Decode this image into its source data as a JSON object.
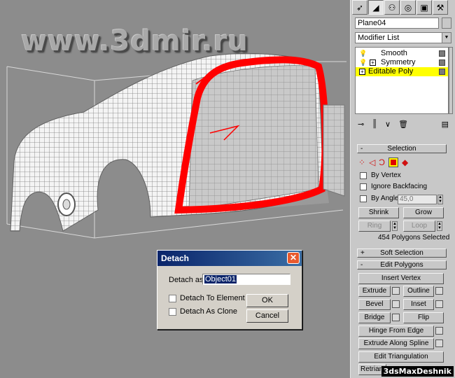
{
  "watermark": "www.3dmir.ru",
  "credit": "3dsMaxDeshnik",
  "detach_dialog": {
    "title": "Detach",
    "detach_as_label": "Detach as:",
    "detach_as_value": "Object01",
    "to_element_label": "Detach To Element",
    "as_clone_label": "Detach As Clone",
    "ok_label": "OK",
    "cancel_label": "Cancel"
  },
  "panel": {
    "tabs": [
      "create-icon",
      "modify-icon",
      "hierarchy-icon",
      "motion-icon",
      "display-icon",
      "utilities-icon"
    ],
    "object_name": "Plane04",
    "modifier_list": "Modifier List",
    "stack": [
      {
        "label": "Smooth",
        "selected": false
      },
      {
        "label": "Symmetry",
        "selected": false
      },
      {
        "label": "Editable Poly",
        "selected": true
      }
    ],
    "selection": {
      "title": "Selection",
      "by_vertex": "By Vertex",
      "ignore_backfacing": "Ignore Backfacing",
      "by_angle": "By Angle:",
      "angle_value": "45,0",
      "shrink": "Shrink",
      "grow": "Grow",
      "ring": "Ring",
      "loop": "Loop",
      "status": "454 Polygons Selected"
    },
    "soft_selection": {
      "title": "Soft Selection"
    },
    "edit_polygons": {
      "title": "Edit Polygons",
      "insert_vertex": "Insert Vertex",
      "extrude": "Extrude",
      "outline": "Outline",
      "bevel": "Bevel",
      "inset": "Inset",
      "bridge": "Bridge",
      "flip": "Flip",
      "hinge_from_edge": "Hinge From Edge",
      "extrude_along_spline": "Extrude Along Spline",
      "edit_triangulation": "Edit Triangulation",
      "retriangulate": "Retrian"
    }
  },
  "colors": {
    "selection_red": "#ff0000",
    "stack_selected": "#ffff00",
    "titlebar": "#0a246a"
  }
}
